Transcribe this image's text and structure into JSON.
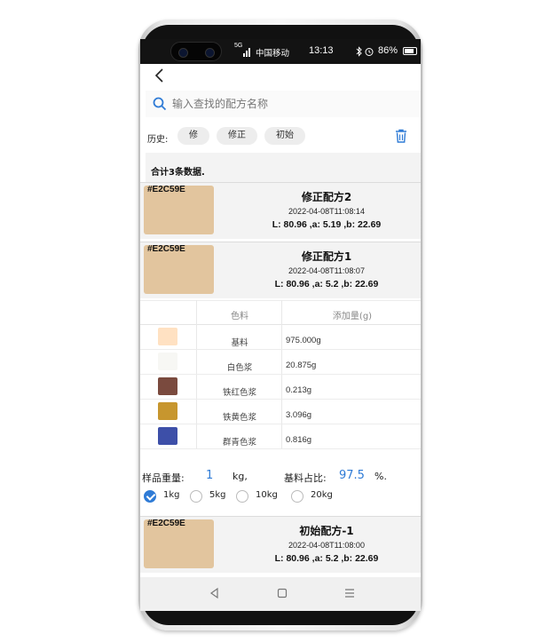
{
  "status_bar": {
    "network": "5G",
    "carrier": "中国移动",
    "time": "13:13",
    "battery": "86%"
  },
  "search": {
    "placeholder": "输入查找的配方名称"
  },
  "history": {
    "label": "历史:",
    "chips": [
      "修",
      "修正",
      "初始"
    ]
  },
  "summary": {
    "count_text": "合计3条数据."
  },
  "recipes": [
    {
      "hex": "#E2C59E",
      "name": "修正配方2",
      "time": "2022-04-08T11:08:14",
      "lab": "L: 80.96 ,a: 5.19 ,b: 22.69"
    },
    {
      "hex": "#E2C59E",
      "name": "修正配方1",
      "time": "2022-04-08T11:08:07",
      "lab": "L: 80.96 ,a: 5.2 ,b: 22.69"
    },
    {
      "hex": "#E2C59E",
      "name": "初始配方-1",
      "time": "2022-04-08T11:08:00",
      "lab": "L: 80.96 ,a: 5.2 ,b: 22.69"
    }
  ],
  "ingredients": {
    "headers": [
      "色料",
      "添加量(g)"
    ],
    "rows": [
      {
        "name": "基料",
        "amount": "975.000g",
        "color": "#FFE1C2"
      },
      {
        "name": "白色浆",
        "amount": "20.875g",
        "color": "#F7F7F4"
      },
      {
        "name": "铁红色浆",
        "amount": "0.213g",
        "color": "#7A4A3E"
      },
      {
        "name": "铁黄色浆",
        "amount": "3.096g",
        "color": "#C7962E"
      },
      {
        "name": "群青色浆",
        "amount": "0.816g",
        "color": "#3D4FA8"
      }
    ]
  },
  "sample": {
    "weight_label": "样品重量:",
    "weight_value": "1",
    "weight_unit": "kg,",
    "ratio_label": "基料占比:",
    "ratio_value": "97.5",
    "ratio_unit": "%.",
    "options": [
      "1kg",
      "5kg",
      "10kg",
      "20kg"
    ],
    "selected": "1kg"
  },
  "colors": {
    "accent": "#2F7BD6",
    "swatch": "#E2C59E"
  },
  "icons": {
    "back": "back-arrow-icon",
    "search": "search-icon",
    "delete": "trash-icon",
    "nav_back": "triangle-back-icon",
    "nav_home": "square-home-icon",
    "nav_menu": "menu-lines-icon"
  }
}
